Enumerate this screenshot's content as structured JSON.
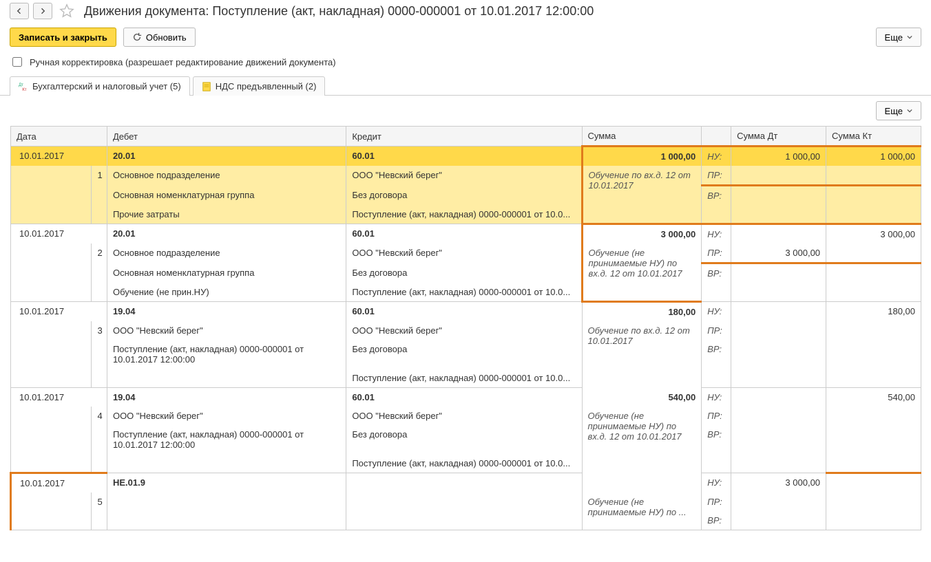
{
  "title": "Движения документа: Поступление (акт, накладная) 0000-000001 от 10.01.2017 12:00:00",
  "toolbar": {
    "save_close": "Записать и закрыть",
    "refresh": "Обновить",
    "more": "Еще"
  },
  "manual_edit": {
    "label": "Ручная корректировка (разрешает редактирование движений документа)"
  },
  "tabs": {
    "accounting": "Бухгалтерский и налоговый учет (5)",
    "vat": "НДС предъявленный (2)"
  },
  "headers": {
    "date": "Дата",
    "debit": "Дебет",
    "credit": "Кредит",
    "sum": "Сумма",
    "sum_dt": "Сумма Дт",
    "sum_kt": "Сумма Кт"
  },
  "labels": {
    "nu": "НУ:",
    "pr": "ПР:",
    "vr": "ВР:"
  },
  "rows": [
    {
      "date": "10.01.2017",
      "idx": "1",
      "debit_acc": "20.01",
      "credit_acc": "60.01",
      "debit_lines": [
        "Основное подразделение",
        "Основная номенклатурная группа",
        "Прочие затраты"
      ],
      "credit_lines": [
        "ООО \"Невский берег\"",
        "Без договора",
        "Поступление (акт, накладная) 0000-000001 от 10.0..."
      ],
      "sum": "1 000,00",
      "desc": "Обучение по вх.д. 12 от 10.01.2017",
      "nu_dt": "1 000,00",
      "nu_kt": "1 000,00",
      "pr_dt": "",
      "pr_kt": "",
      "vr_dt": "",
      "vr_kt": "",
      "hl": true
    },
    {
      "date": "10.01.2017",
      "idx": "2",
      "debit_acc": "20.01",
      "credit_acc": "60.01",
      "debit_lines": [
        "Основное подразделение",
        "Основная номенклатурная группа",
        "Обучение (не прин.НУ)"
      ],
      "credit_lines": [
        "ООО \"Невский берег\"",
        "Без договора",
        "Поступление (акт, накладная) 0000-000001 от 10.0..."
      ],
      "sum": "3 000,00",
      "desc": "Обучение (не принимаемые НУ) по вх.д. 12 от 10.01.2017",
      "nu_dt": "",
      "nu_kt": "3 000,00",
      "pr_dt": "3 000,00",
      "pr_kt": "",
      "vr_dt": "",
      "vr_kt": ""
    },
    {
      "date": "10.01.2017",
      "idx": "3",
      "debit_acc": "19.04",
      "credit_acc": "60.01",
      "debit_lines": [
        "ООО \"Невский берег\"",
        "Поступление (акт, накладная) 0000-000001 от 10.01.2017 12:00:00"
      ],
      "credit_lines": [
        "ООО \"Невский берег\"",
        "Без договора",
        "Поступление (акт, накладная) 0000-000001 от 10.0..."
      ],
      "sum": "180,00",
      "desc": "Обучение по вх.д. 12 от 10.01.2017",
      "nu_dt": "",
      "nu_kt": "180,00",
      "pr_dt": "",
      "pr_kt": "",
      "vr_dt": "",
      "vr_kt": ""
    },
    {
      "date": "10.01.2017",
      "idx": "4",
      "debit_acc": "19.04",
      "credit_acc": "60.01",
      "debit_lines": [
        "ООО \"Невский берег\"",
        "Поступление (акт, накладная) 0000-000001 от 10.01.2017 12:00:00"
      ],
      "credit_lines": [
        "ООО \"Невский берег\"",
        "Без договора",
        "Поступление (акт, накладная) 0000-000001 от 10.0..."
      ],
      "sum": "540,00",
      "desc": "Обучение (не принимаемые НУ) по вх.д. 12 от 10.01.2017",
      "nu_dt": "",
      "nu_kt": "540,00",
      "pr_dt": "",
      "pr_kt": "",
      "vr_dt": "",
      "vr_kt": ""
    },
    {
      "date": "10.01.2017",
      "idx": "5",
      "debit_acc": "НЕ.01.9",
      "credit_acc": "",
      "debit_lines": [
        "",
        ""
      ],
      "credit_lines": [
        "",
        ""
      ],
      "sum": "",
      "desc": "Обучение (не принимаемые НУ) по ...",
      "nu_dt": "3 000,00",
      "nu_kt": "",
      "pr_dt": "",
      "pr_kt": "",
      "vr_dt": "",
      "vr_kt": "",
      "boxed": true
    }
  ]
}
